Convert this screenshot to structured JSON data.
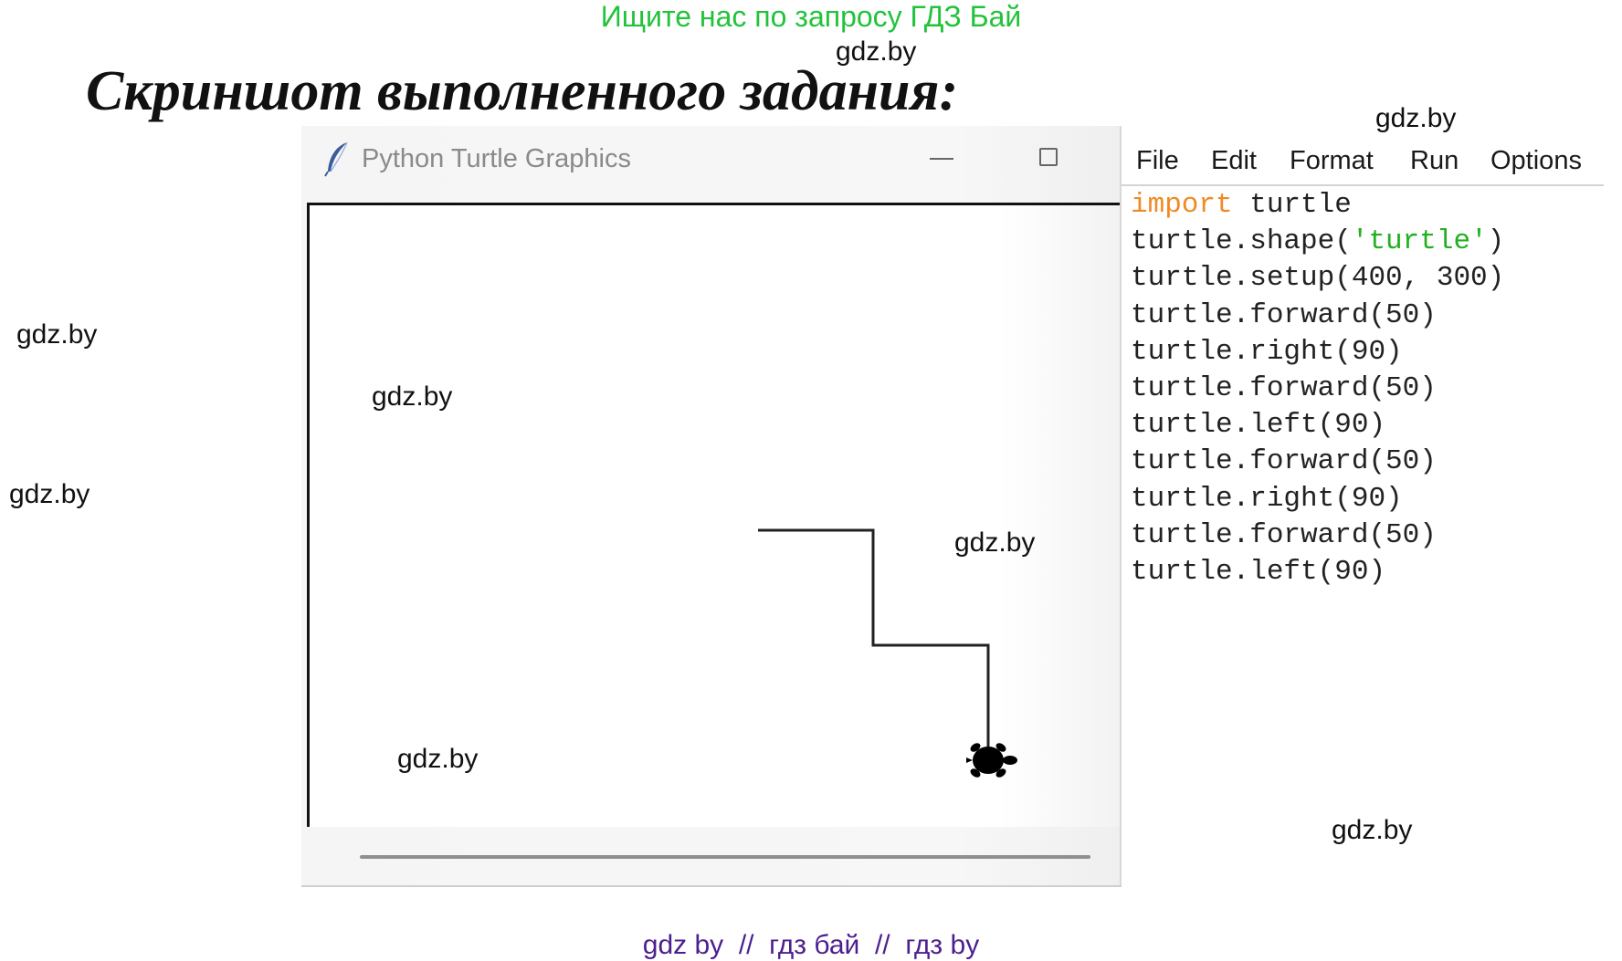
{
  "promo": {
    "top_text": "Ищите нас по запросу ГДЗ Бай",
    "footer_text": "gdz by  //  гдз бай  //  гдз by"
  },
  "watermarks": [
    "gdz.by",
    "gdz.by",
    "gdz.by",
    "gdz.by",
    "gdz.by",
    "gdz.by",
    "gdz.by",
    "gdz.by"
  ],
  "heading": "Скриншот выполненного задания:",
  "turtle_window": {
    "title": "Python Turtle Graphics",
    "icon": "feather-icon",
    "controls": [
      "minimize-icon",
      "maximize-icon"
    ]
  },
  "editor": {
    "menu": [
      "File",
      "Edit",
      "Format",
      "Run",
      "Options"
    ],
    "code": {
      "kw_import": "import",
      "line1_rest": " turtle",
      "line2_pre": "turtle.shape(",
      "line2_str": "'turtle'",
      "line2_post": ")",
      "lines": [
        "turtle.setup(400, 300)",
        "turtle.forward(50)",
        "turtle.right(90)",
        "turtle.forward(50)",
        "turtle.left(90)",
        "turtle.forward(50)",
        "turtle.right(90)",
        "turtle.forward(50)",
        "turtle.left(90)"
      ]
    }
  },
  "colors": {
    "promo_green": "#22c33a",
    "footer_purple": "#4b1f8e",
    "keyword_orange": "#f08a25",
    "string_green": "#22b022"
  }
}
